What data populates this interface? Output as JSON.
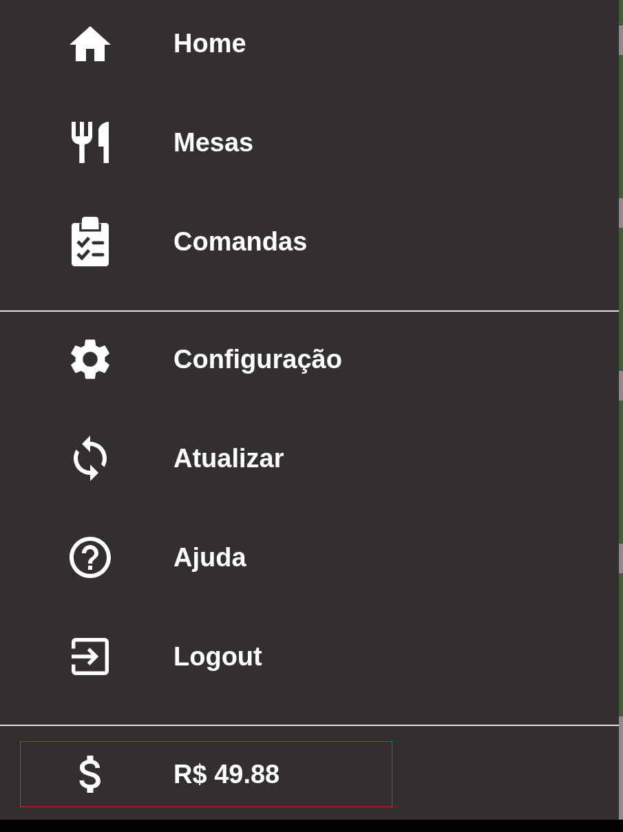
{
  "menu": {
    "sections": [
      {
        "items": [
          {
            "label": "Home"
          },
          {
            "label": "Mesas"
          },
          {
            "label": "Comandas"
          }
        ]
      },
      {
        "items": [
          {
            "label": "Configuração"
          },
          {
            "label": "Atualizar"
          },
          {
            "label": "Ajuda"
          },
          {
            "label": "Logout"
          }
        ]
      }
    ]
  },
  "balance": {
    "amount": "R$ 49.88"
  }
}
